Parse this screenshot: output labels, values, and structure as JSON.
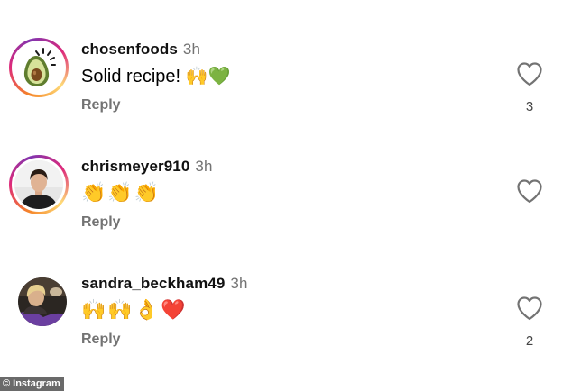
{
  "comments": [
    {
      "username": "chosenfoods",
      "time": "3h",
      "text": "Solid recipe! 🙌💚",
      "reply_label": "Reply",
      "likes": "3",
      "avatar": "avocado-logo",
      "story_ring": true
    },
    {
      "username": "chrismeyer910",
      "time": "3h",
      "text": "👏👏👏",
      "reply_label": "Reply",
      "likes": "",
      "avatar": "profile-photo",
      "story_ring": true
    },
    {
      "username": "sandra_beckham49",
      "time": "3h",
      "text": "🙌🙌👌❤️",
      "reply_label": "Reply",
      "likes": "2",
      "avatar": "profile-photo",
      "story_ring": false
    }
  ],
  "watermark": "© Instagram",
  "colors": {
    "secondary_text": "#737373",
    "primary_text": "#000000",
    "background": "#ffffff"
  },
  "icons": [
    "heart-outline-icon",
    "avocado-logo-icon"
  ]
}
